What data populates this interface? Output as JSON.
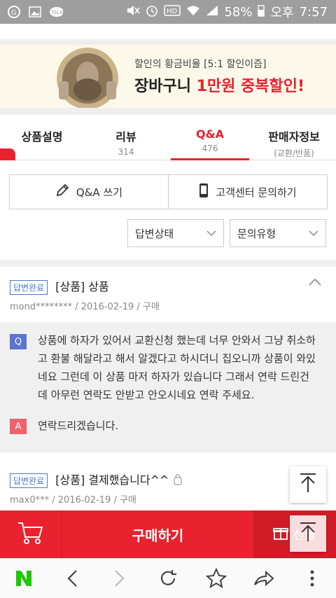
{
  "statusbar": {
    "battery": "58%",
    "ampm": "오후",
    "time": "7:57"
  },
  "banner": {
    "line1": "할인의 황금비율 [5:1 할인이즘]",
    "line2_a": "장바구니 ",
    "line2_b": "1만원 중복할인!"
  },
  "tabs": [
    {
      "label": "상품설명",
      "count": ""
    },
    {
      "label": "리뷰",
      "count": "314"
    },
    {
      "label": "Q&A",
      "count": "476"
    },
    {
      "label": "판매자정보",
      "count": "(교환/반품)"
    }
  ],
  "actions": {
    "write_qa": "Q&A 쓰기",
    "contact_center": "고객센터 문의하기"
  },
  "filters": {
    "answer_status": "답변상태",
    "inquiry_type": "문의유형"
  },
  "items": [
    {
      "badge": "답변완료",
      "title": "[상품] 상품",
      "author": "mond********",
      "date": "2016-02-19",
      "type": "구매"
    },
    {
      "badge": "답변완료",
      "title": "[상품] 결제했습니다^^",
      "author": "max0***",
      "date": "2016-02-19",
      "type": "구매"
    }
  ],
  "qa": {
    "q_mark": "Q",
    "question": "상품에 하자가 있어서 교환신청 했는데 너무 안와서 그냥 취소하고 환불 해달라고 해서 알겠다고 하시더니 집오니까 상품이 와있네요 그런데 이 상품 마저 하자가 있습니다 그래서 연락 드린건데 아무런 연락도 안받고 안오시네요 연락 주세요.",
    "a_mark": "A",
    "answer": "연락드리겠습니다."
  },
  "buybar": {
    "buy": "구매하기",
    "gift": "선물"
  },
  "colors": {
    "accent": "#e8222e",
    "badge_blue": "#4a79c8",
    "q_blue": "#5b73d1",
    "a_red": "#f0616b"
  }
}
